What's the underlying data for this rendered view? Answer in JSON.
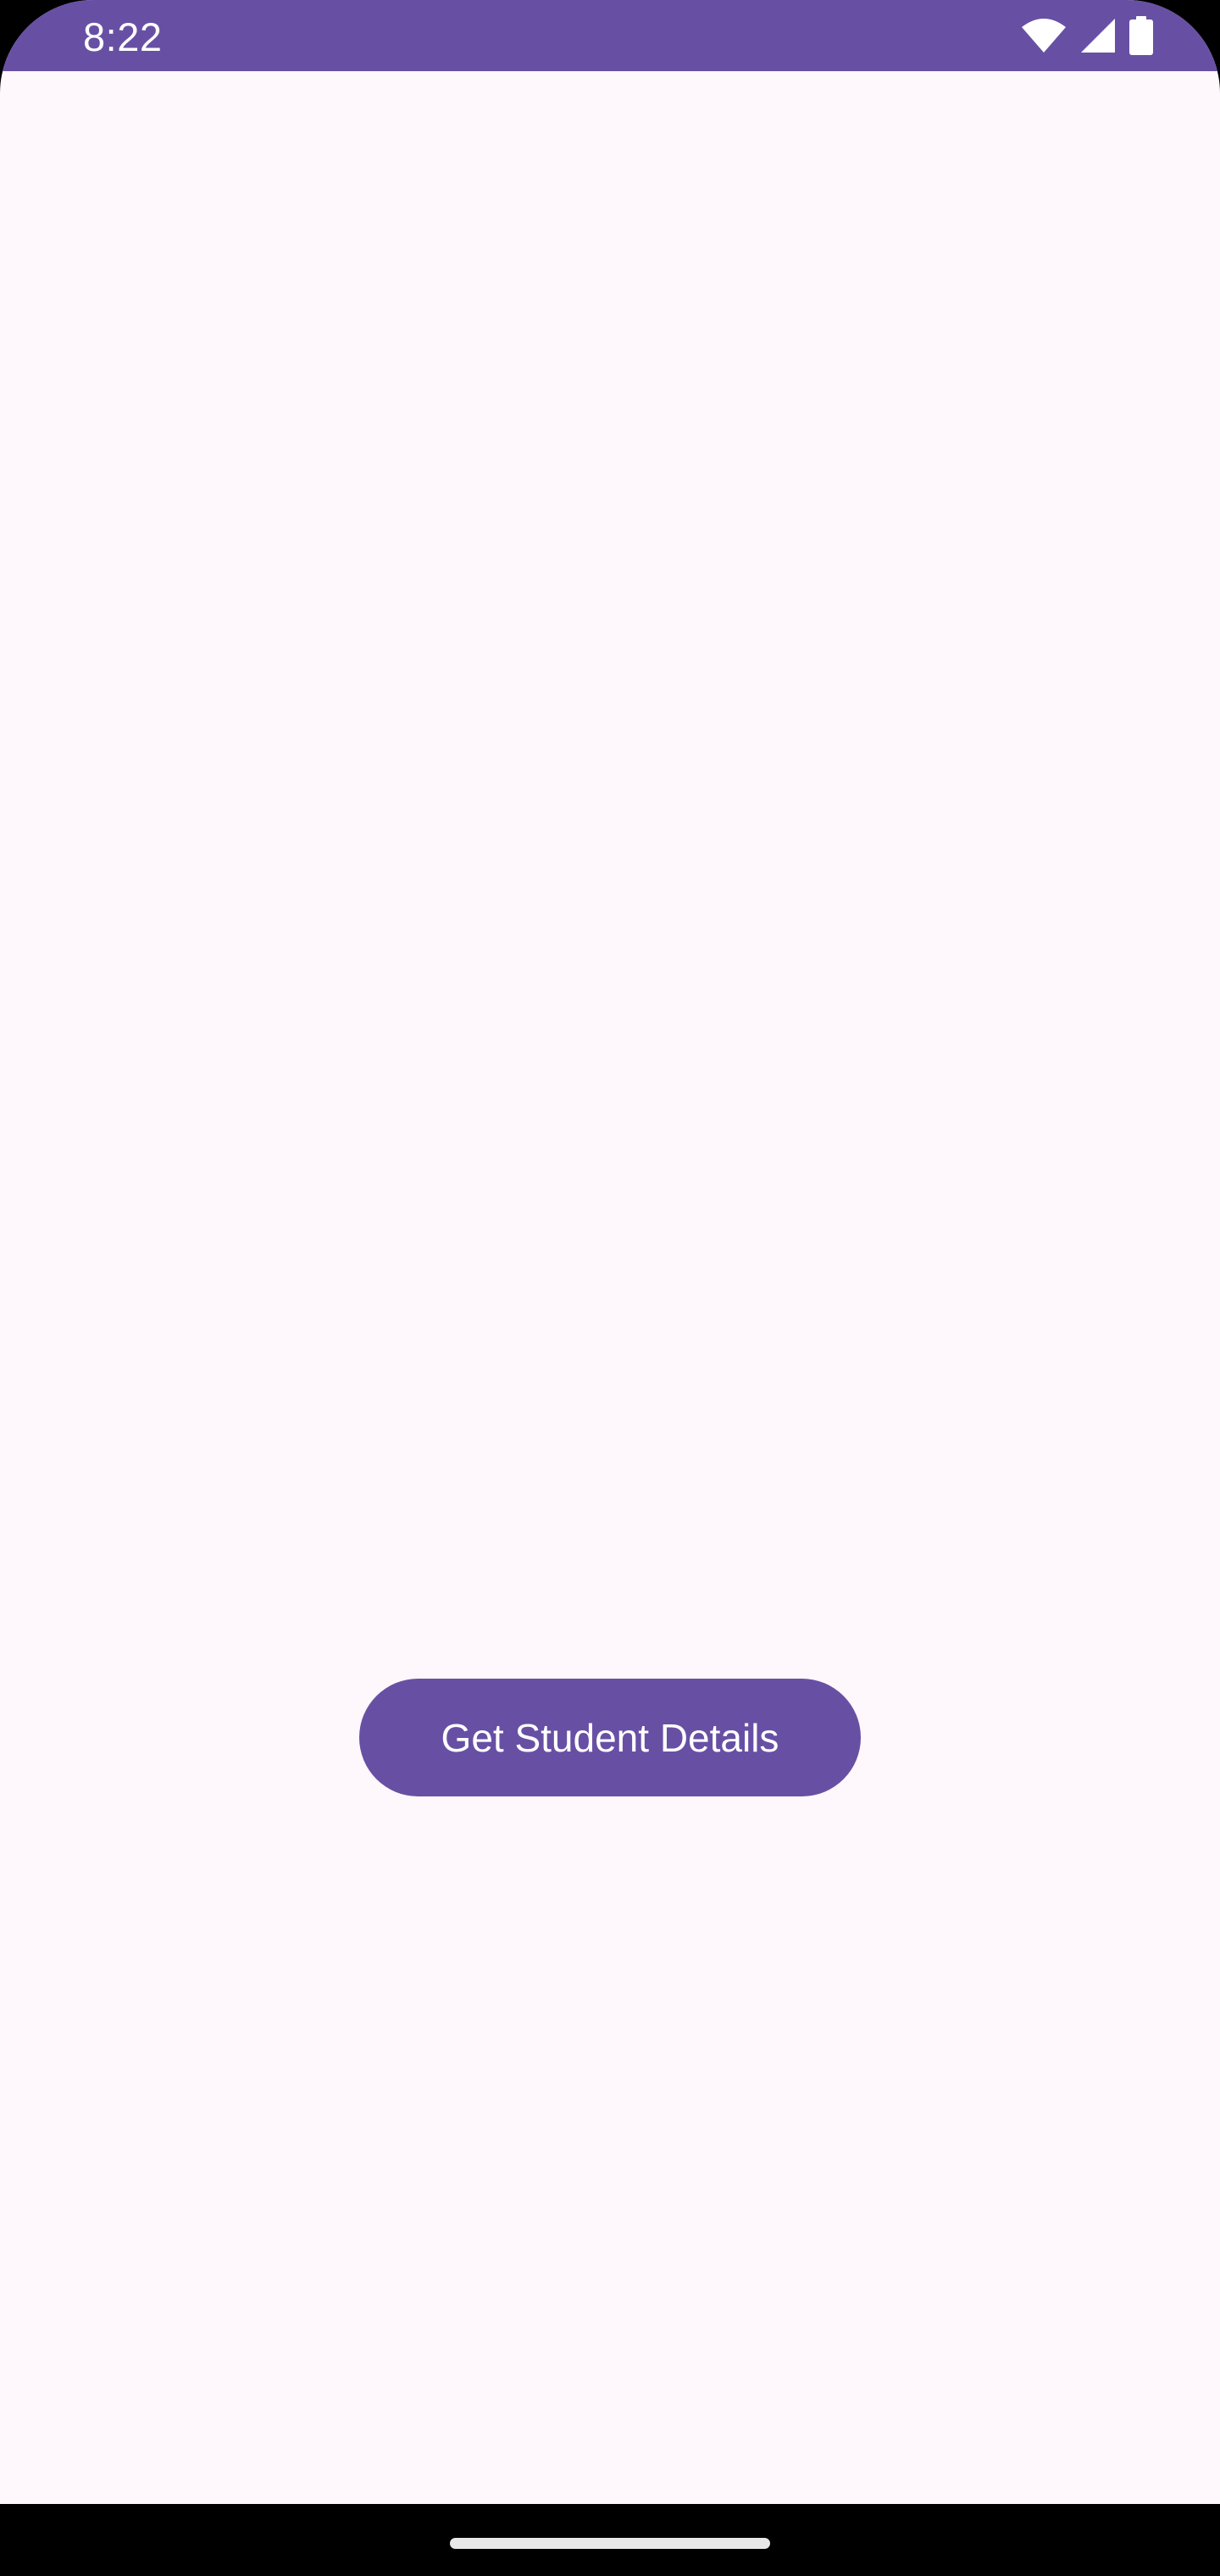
{
  "status_bar": {
    "time": "8:22",
    "icons": [
      "wifi-icon",
      "cellular-signal-icon",
      "battery-icon"
    ],
    "background_color": "#6750a4"
  },
  "main": {
    "button_label": "Get Student Details",
    "background_color": "#fef7fb",
    "button_color": "#6750a4"
  },
  "navigation": {
    "handle": "home-gesture-handle"
  }
}
